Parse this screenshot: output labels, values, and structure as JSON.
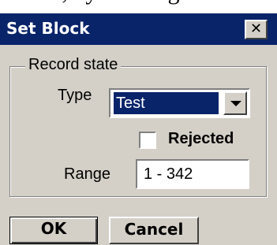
{
  "background_text": "blocks, by clicking the Set Bl",
  "dialog": {
    "title": "Set Block",
    "close_symbol": "✕"
  },
  "record_state": {
    "legend": "Record state",
    "type_label": "Type",
    "type_value": "Test",
    "rejected_label": "Rejected",
    "rejected_checked": false,
    "range_label": "Range",
    "range_value": "1 - 342"
  },
  "buttons": {
    "ok": "OK",
    "cancel": "Cancel"
  },
  "colors": {
    "title_bar": "#0a246a",
    "face": "#d4d0c8",
    "selection": "#0a246a"
  },
  "icons": {
    "close": "close-icon",
    "dropdown": "chevron-down-icon"
  }
}
